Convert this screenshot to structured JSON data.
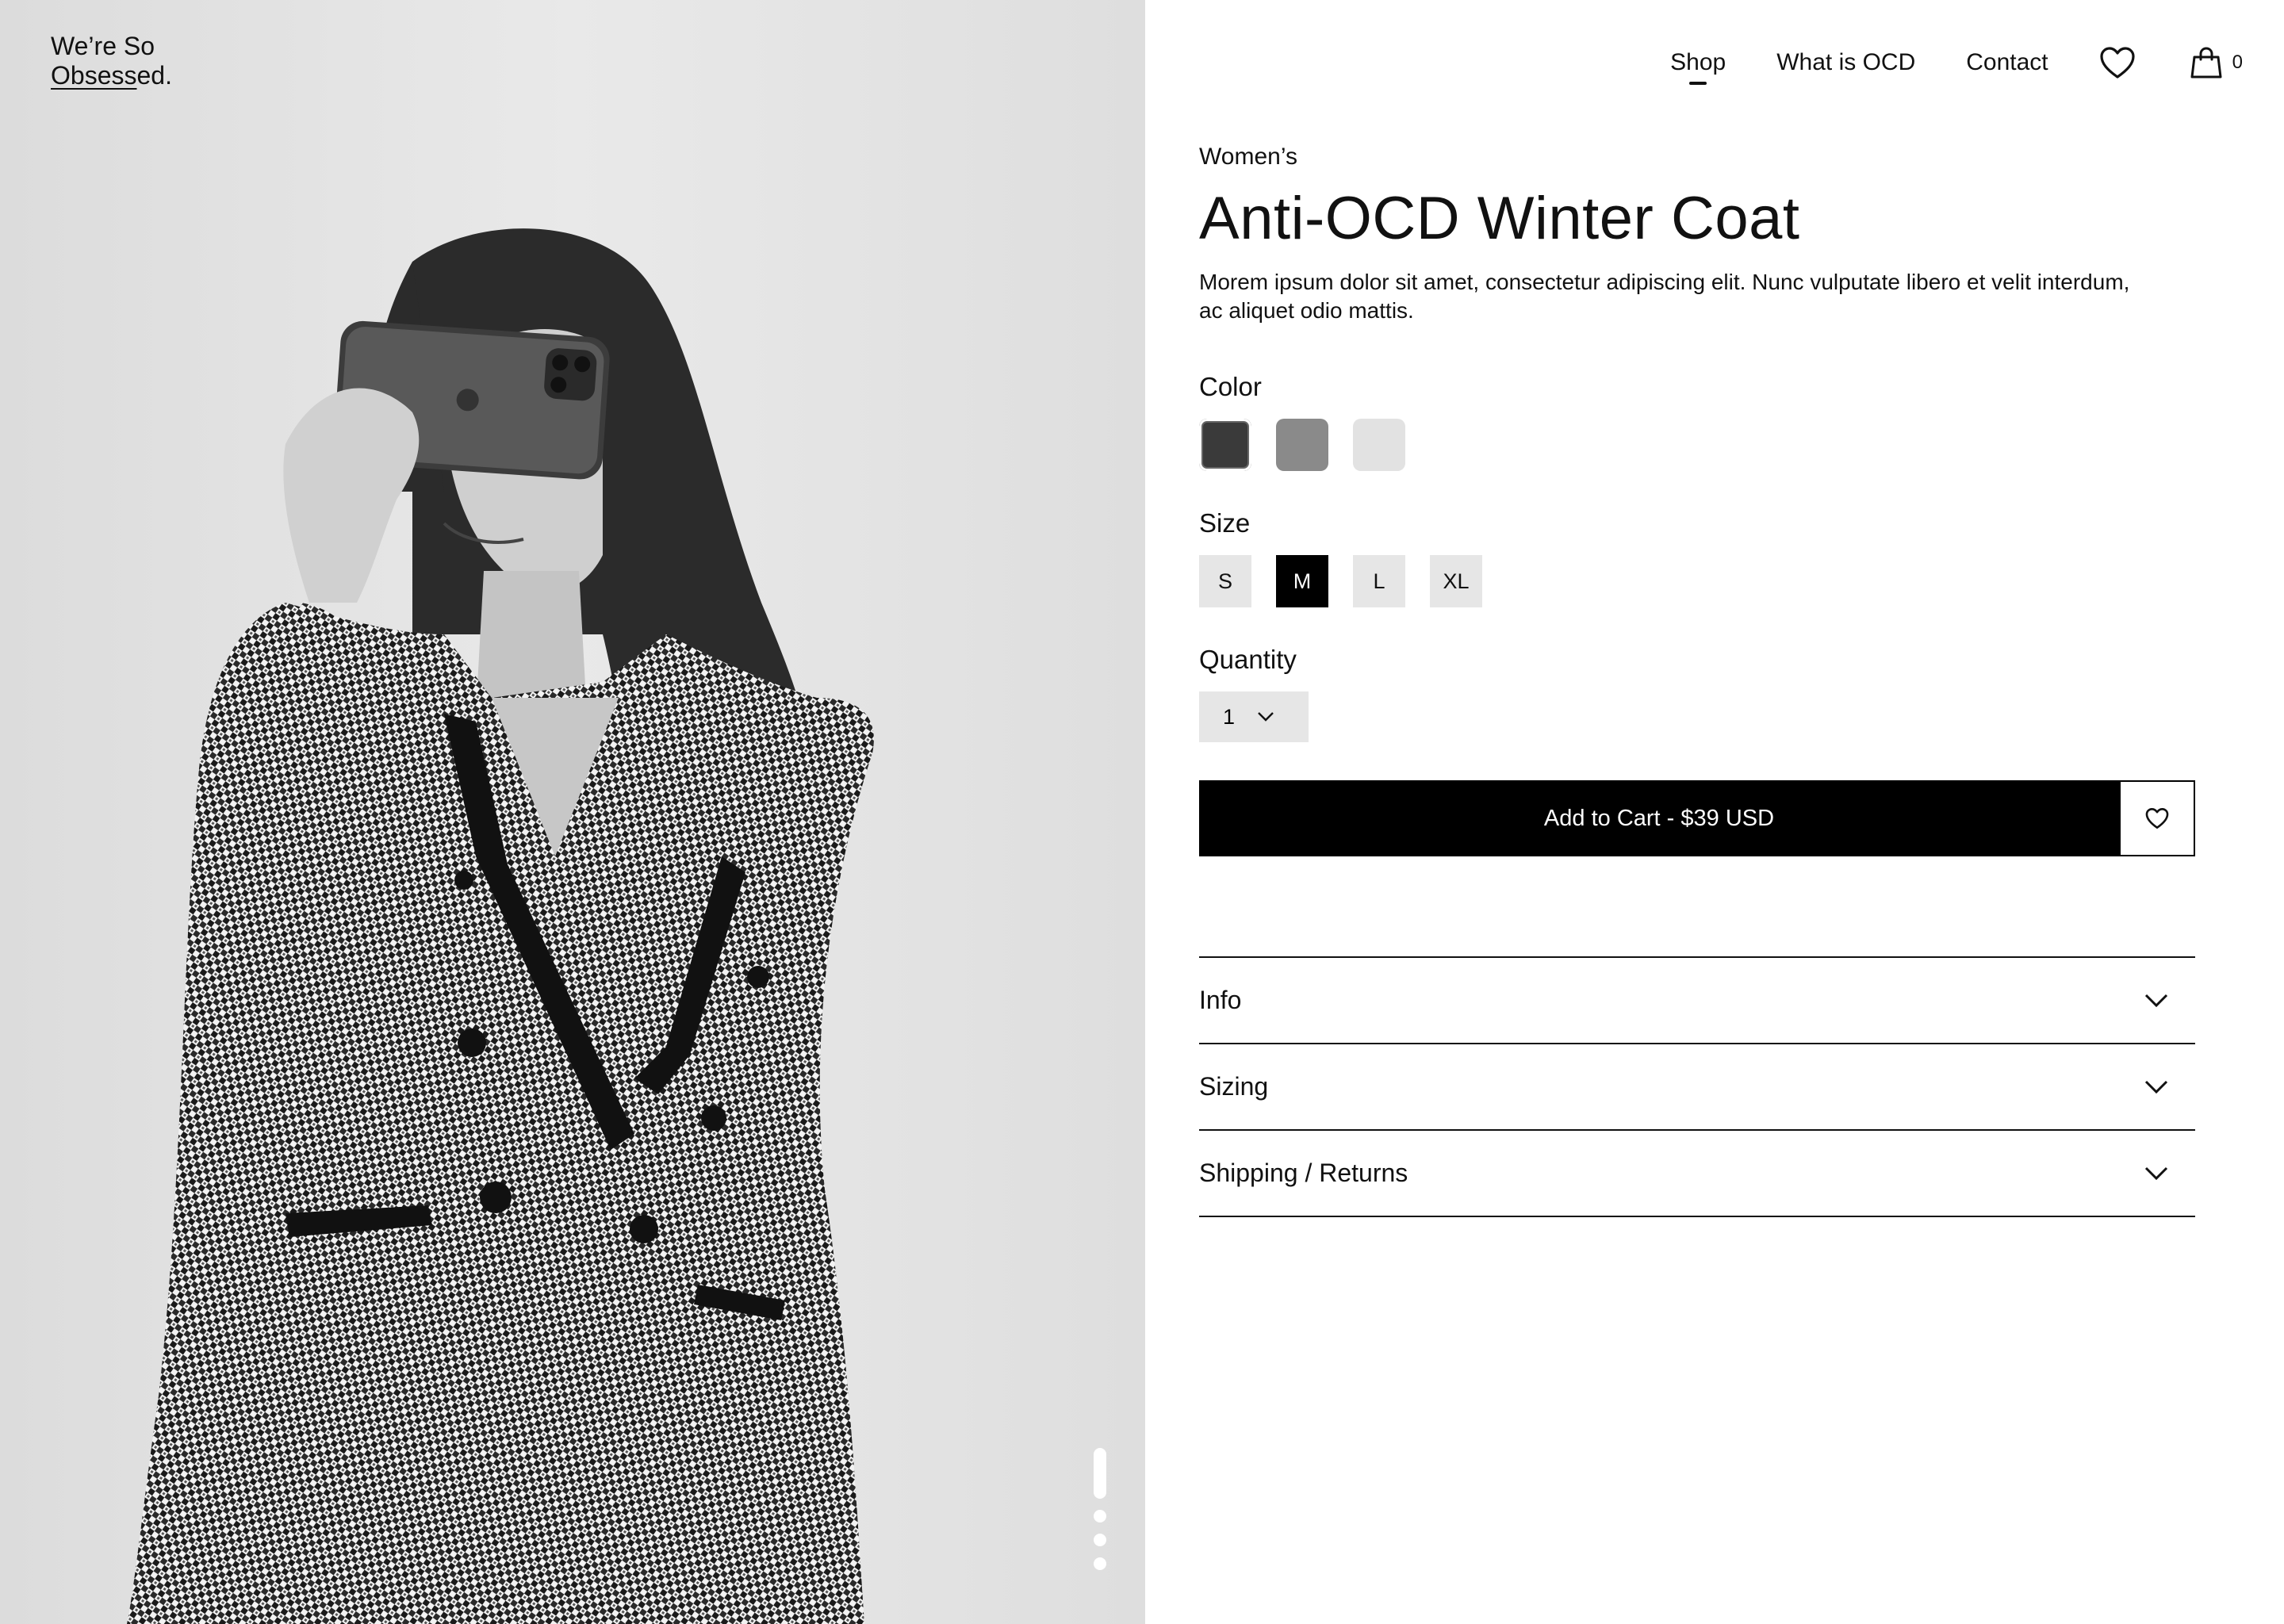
{
  "brand": {
    "logo_line1": "We’re So",
    "logo_line2_underlined": "Obsess",
    "logo_line2_rest": "ed."
  },
  "nav": {
    "items": [
      "Shop",
      "What is OCD",
      "Contact"
    ],
    "active": "Shop",
    "wishlist_icon": "heart-icon",
    "cart_icon": "shopping-bag-icon",
    "cart_count": "0"
  },
  "product": {
    "category": "Women’s",
    "title": "Anti-OCD Winter Coat",
    "description": "Morem ipsum dolor sit amet, consectetur adipiscing elit. Nunc vulputate libero et velit interdum, ac aliquet odio mattis."
  },
  "options": {
    "color_label": "Color",
    "colors": [
      "#3a3a3a",
      "#8a8a8a",
      "#e2e2e2"
    ],
    "selected_color": 0,
    "size_label": "Size",
    "sizes": [
      "S",
      "M",
      "L",
      "XL"
    ],
    "selected_size": "M",
    "quantity_label": "Quantity",
    "quantity": "1"
  },
  "actions": {
    "add_to_cart": "Add to Cart - $39 USD",
    "wishlist_icon": "heart-icon"
  },
  "accordion": [
    "Info",
    "Sizing",
    "Shipping / Returns"
  ],
  "gallery": {
    "slides": 4,
    "active_slide": 1
  }
}
